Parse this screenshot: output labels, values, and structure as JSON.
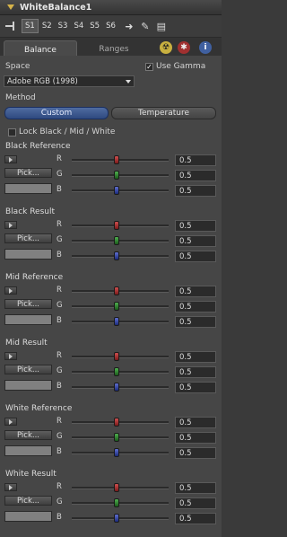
{
  "window": {
    "title": "WhiteBalance1"
  },
  "toolbar": {
    "slots": [
      "S1",
      "S2",
      "S3",
      "S4",
      "S5",
      "S6"
    ],
    "active_slot": "S1"
  },
  "tabs": [
    {
      "label": "Balance",
      "active": true
    },
    {
      "label": "Ranges",
      "active": false
    }
  ],
  "space": {
    "label": "Space",
    "value": "Adobe RGB (1998)",
    "use_gamma_label": "Use Gamma",
    "use_gamma_checked": true
  },
  "method": {
    "label": "Method",
    "options": [
      "Custom",
      "Temperature"
    ],
    "selected": "Custom"
  },
  "lock": {
    "label": "Lock Black / Mid / White",
    "checked": false
  },
  "controls": {
    "pick_label": "Pick...",
    "channels": [
      "R",
      "G",
      "B"
    ]
  },
  "sections": [
    {
      "title": "Black Reference",
      "r": "0.5",
      "g": "0.5",
      "b": "0.5"
    },
    {
      "title": "Black Result",
      "r": "0.5",
      "g": "0.5",
      "b": "0.5"
    },
    {
      "title": "Mid Reference",
      "r": "0.5",
      "g": "0.5",
      "b": "0.5"
    },
    {
      "title": "Mid Result",
      "r": "0.5",
      "g": "0.5",
      "b": "0.5"
    },
    {
      "title": "White Reference",
      "r": "0.5",
      "g": "0.5",
      "b": "0.5"
    },
    {
      "title": "White Result",
      "r": "0.5",
      "g": "0.5",
      "b": "0.5"
    }
  ],
  "colors": {
    "accent": "#3a5a9a",
    "swatch": "#808080"
  }
}
